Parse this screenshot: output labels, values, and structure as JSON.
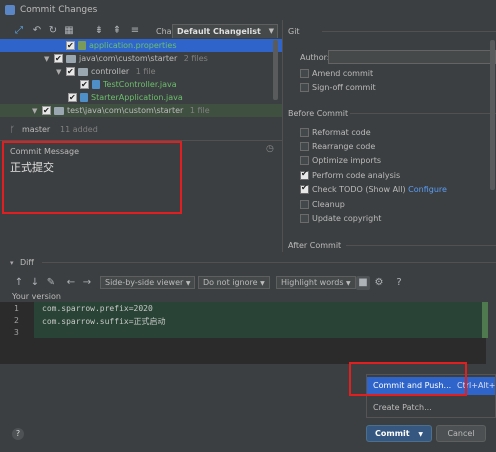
{
  "window": {
    "title": "Commit Changes"
  },
  "toolbar": {
    "changelist_label": "Changelist:",
    "changelist_value": "Default Changelist"
  },
  "tree": {
    "rows": [
      {
        "name": "application.properties"
      },
      {
        "name": "java\\com\\custom\\starter",
        "count": "2 files"
      },
      {
        "name": "controller",
        "count": "1 file"
      },
      {
        "name": "TestController.java"
      },
      {
        "name": "StarterApplication.java"
      },
      {
        "name": "test\\java\\com\\custom\\starter",
        "count": "1 file"
      }
    ]
  },
  "status": {
    "branch": "master",
    "added": "11 added"
  },
  "commit_message": {
    "label": "Commit Message",
    "text": "正式提交"
  },
  "git": {
    "section_title": "Git",
    "author_label": "Author:",
    "amend": "Amend commit",
    "signoff": "Sign-off commit"
  },
  "before_commit": {
    "title": "Before Commit",
    "reformat": "Reformat code",
    "rearrange": "Rearrange code",
    "optimize": "Optimize imports",
    "analyze": "Perform code analysis",
    "todo": "Check TODO (Show All)",
    "configure": "Configure",
    "cleanup": "Cleanup",
    "copyright": "Update copyright"
  },
  "after_commit": {
    "title": "After Commit"
  },
  "diff": {
    "title": "Diff",
    "viewer": "Side-by-side viewer",
    "ignore": "Do not ignore",
    "highlight": "Highlight words",
    "help": "?",
    "version_label": "Your version",
    "lines": [
      {
        "num": "1",
        "text": "com.sparrow.prefix=2020"
      },
      {
        "num": "2",
        "text": "com.sparrow.suffix=正式启动"
      },
      {
        "num": "3",
        "text": ""
      }
    ]
  },
  "popup": {
    "commit_push": "Commit and Push...",
    "shortcut": "Ctrl+Alt+K",
    "create_patch": "Create Patch..."
  },
  "buttons": {
    "commit": "Commit",
    "cancel": "Cancel",
    "help": "?"
  },
  "colors": {
    "accent": "#2f65ca",
    "annotation": "#e02020",
    "diff_added": "#294436"
  }
}
